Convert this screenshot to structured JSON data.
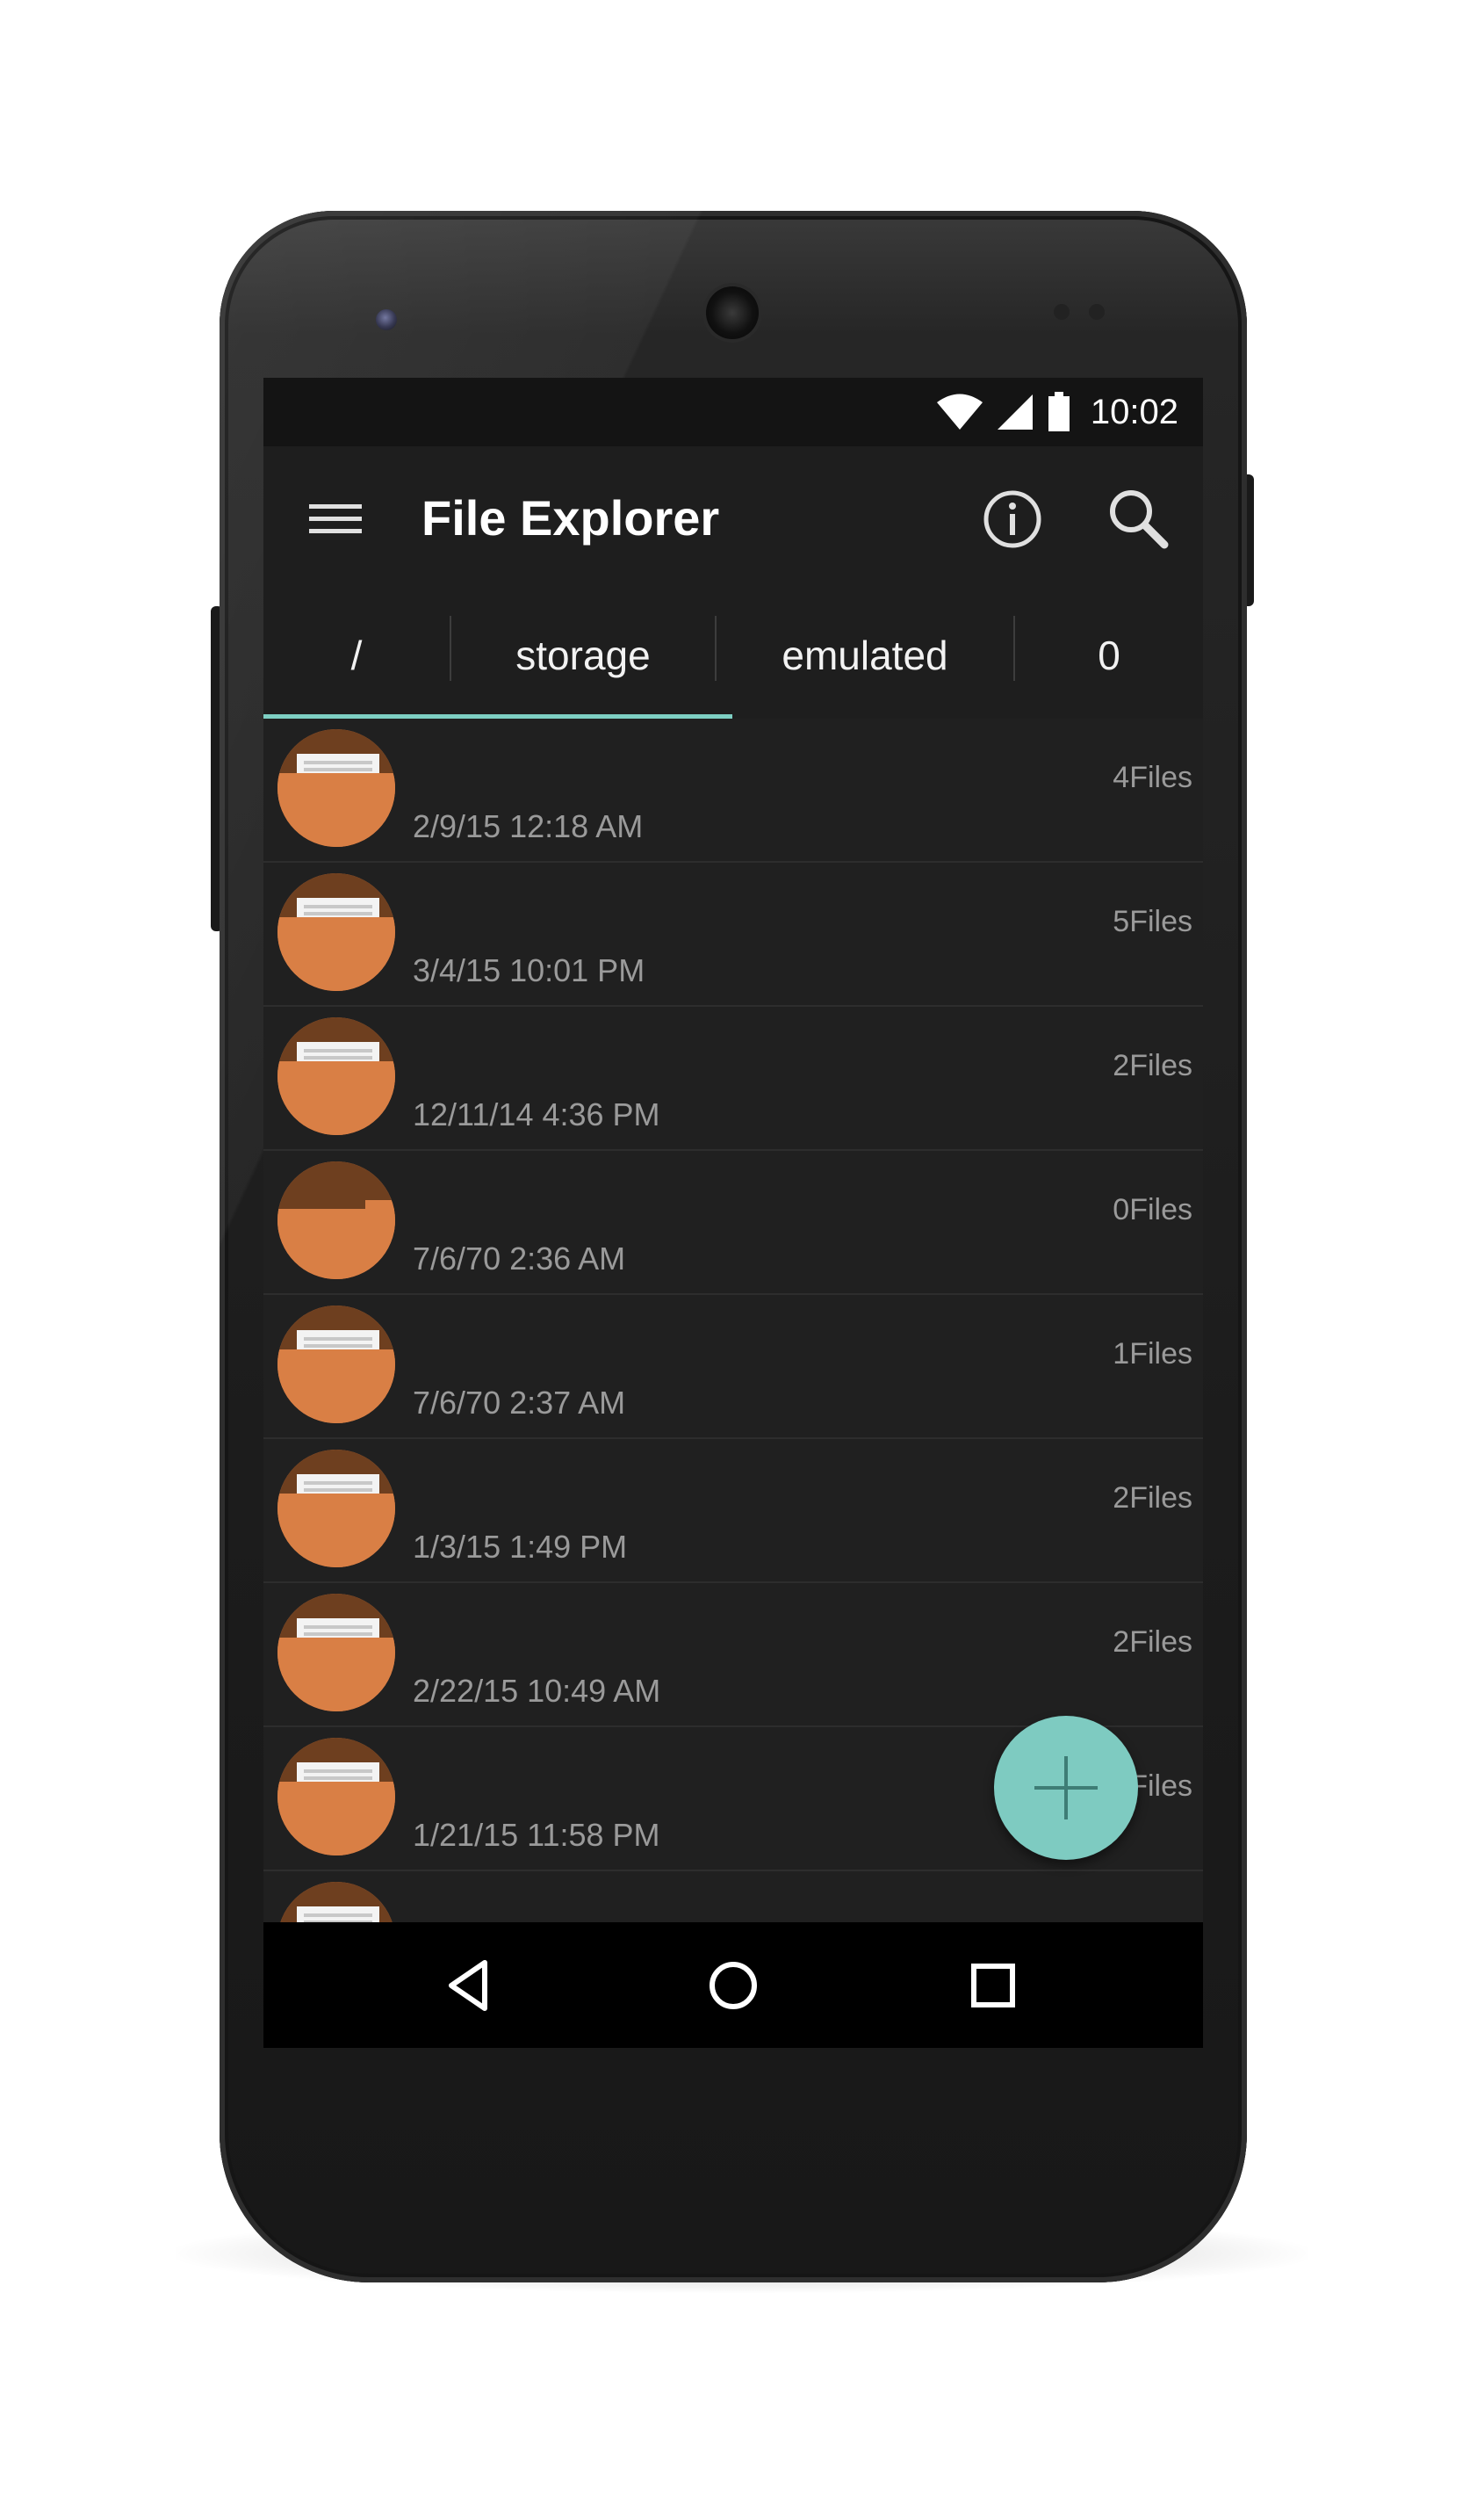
{
  "status_bar": {
    "time": "10:02",
    "icons": [
      "wifi-icon",
      "cell-signal-icon",
      "battery-icon"
    ]
  },
  "app_bar": {
    "title": "File Explorer",
    "actions": [
      "info-icon",
      "search-icon"
    ],
    "nav_icon": "menu-icon"
  },
  "breadcrumb_tabs": [
    {
      "label": "/",
      "selected": true
    },
    {
      "label": "storage",
      "selected": false
    },
    {
      "label": "emulated",
      "selected": false
    },
    {
      "label": "0",
      "selected": false
    }
  ],
  "files": [
    {
      "icon": "folder-icon",
      "date": "2/9/15 12:18 AM",
      "count": "4Files"
    },
    {
      "icon": "folder-icon",
      "date": "3/4/15 10:01 PM",
      "count": "5Files"
    },
    {
      "icon": "folder-icon",
      "date": "12/11/14 4:36 PM",
      "count": "2Files"
    },
    {
      "icon": "empty-folder-icon",
      "date": "7/6/70 2:36 AM",
      "count": "0Files"
    },
    {
      "icon": "folder-icon",
      "date": "7/6/70 2:37 AM",
      "count": "1Files"
    },
    {
      "icon": "folder-icon",
      "date": "1/3/15 1:49 PM",
      "count": "2Files"
    },
    {
      "icon": "folder-icon",
      "date": "2/22/15 10:49 AM",
      "count": "2Files"
    },
    {
      "icon": "folder-icon",
      "date": "1/21/15 11:58 PM",
      "count": "Files"
    }
  ],
  "fab": {
    "icon": "plus-icon"
  },
  "nav_bar": {
    "buttons": [
      "back-icon",
      "home-icon",
      "recents-icon"
    ]
  },
  "colors": {
    "accent": "#7ecbc1",
    "folder": "#d97f45",
    "folder_back": "#6e3f1f",
    "background": "#202020",
    "toolbar": "#1e1e1e"
  }
}
